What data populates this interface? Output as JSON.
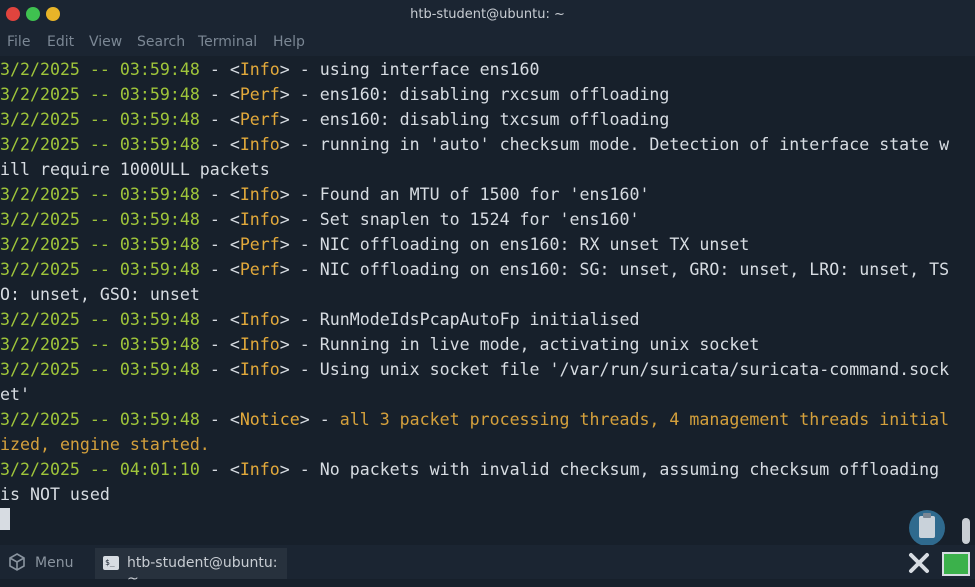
{
  "window": {
    "title": "htb-student@ubuntu: ~"
  },
  "menu": {
    "file": "File",
    "edit": "Edit",
    "view": "View",
    "search": "Search",
    "terminal": "Terminal",
    "help": "Help"
  },
  "log": [
    {
      "date": "3/2/2025",
      "time": "03:59:48",
      "tag": "Info",
      "msg": "using interface ens160"
    },
    {
      "date": "3/2/2025",
      "time": "03:59:48",
      "tag": "Perf",
      "msg": "ens160: disabling rxcsum offloading"
    },
    {
      "date": "3/2/2025",
      "time": "03:59:48",
      "tag": "Perf",
      "msg": "ens160: disabling txcsum offloading"
    },
    {
      "date": "3/2/2025",
      "time": "03:59:48",
      "tag": "Info",
      "msg": "running in 'auto' checksum mode. Detection of interface state w",
      "cont": "ill require 1000ULL packets"
    },
    {
      "date": "3/2/2025",
      "time": "03:59:48",
      "tag": "Info",
      "msg": "Found an MTU of 1500 for 'ens160'"
    },
    {
      "date": "3/2/2025",
      "time": "03:59:48",
      "tag": "Info",
      "msg": "Set snaplen to 1524 for 'ens160'"
    },
    {
      "date": "3/2/2025",
      "time": "03:59:48",
      "tag": "Perf",
      "msg": "NIC offloading on ens160: RX unset TX unset"
    },
    {
      "date": "3/2/2025",
      "time": "03:59:48",
      "tag": "Perf",
      "msg": "NIC offloading on ens160: SG: unset, GRO: unset, LRO: unset, TS",
      "cont": "O: unset, GSO: unset"
    },
    {
      "date": "3/2/2025",
      "time": "03:59:48",
      "tag": "Info",
      "msg": "RunModeIdsPcapAutoFp initialised"
    },
    {
      "date": "3/2/2025",
      "time": "03:59:48",
      "tag": "Info",
      "msg": "Running in live mode, activating unix socket"
    },
    {
      "date": "3/2/2025",
      "time": "03:59:48",
      "tag": "Info",
      "msg": "Using unix socket file '/var/run/suricata/suricata-command.sock",
      "cont": "et'"
    },
    {
      "date": "3/2/2025",
      "time": "03:59:48",
      "tag": "Notice",
      "msg": "all 3 packet processing threads, 4 management threads initial",
      "cont": "ized, engine started."
    },
    {
      "date": "3/2/2025",
      "time": "04:01:10",
      "tag": "Info",
      "msg": "No packets with invalid checksum, assuming checksum offloading",
      "cont": "is NOT used"
    }
  ],
  "taskbar": {
    "menu_label": "Menu",
    "task_label": "htb-student@ubuntu: ~",
    "task_icon_text": "$_"
  },
  "colors": {
    "date": "#9fc53a",
    "tag": "#e2a93b",
    "notice_msg": "#d4a03c",
    "text": "#d7dce2",
    "background": "#17202b"
  },
  "icons": {
    "menu": "cube-icon",
    "clipboard": "clipboard-icon",
    "close": "close-icon",
    "monitor": "monitor-icon",
    "terminal": "terminal-icon"
  }
}
